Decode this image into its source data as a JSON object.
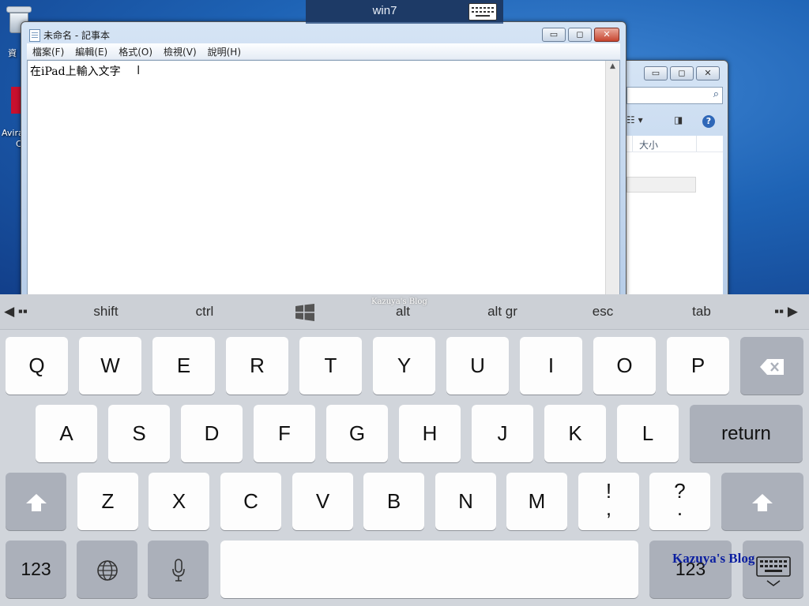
{
  "remote_bar": {
    "title": "win7",
    "keyboard_icon": "keyboard-icon"
  },
  "desktop": {
    "icons": [
      {
        "label": "資",
        "icon": "recycle-bin-icon"
      },
      {
        "label_line1": "Avira",
        "label_line2": "C",
        "icon": "avira-icon"
      }
    ]
  },
  "notepad": {
    "title": "未命名 - 記事本",
    "menu": [
      "檔案(F)",
      "編輯(E)",
      "格式(O)",
      "檢視(V)",
      "說明(H)"
    ],
    "content": "在iPad上輸入文字",
    "window_buttons": {
      "minimize": "▭",
      "maximize": "◻",
      "close": "✕"
    }
  },
  "explorer": {
    "window_buttons": {
      "minimize": "▭",
      "maximize": "◻",
      "close": "✕"
    },
    "column_header": "大小",
    "help": "?"
  },
  "keyboard": {
    "function_row": {
      "left_arrow": "◀",
      "shift": "shift",
      "ctrl": "ctrl",
      "watermark": "Kazuya's Blog",
      "alt": "alt",
      "altgr": "alt gr",
      "esc": "esc",
      "tab": "tab",
      "right_arrow": "▶"
    },
    "row1": [
      "Q",
      "W",
      "E",
      "R",
      "T",
      "Y",
      "U",
      "I",
      "O",
      "P"
    ],
    "row2": [
      "A",
      "S",
      "D",
      "F",
      "G",
      "H",
      "J",
      "K",
      "L"
    ],
    "return": "return",
    "row3": [
      "Z",
      "X",
      "C",
      "V",
      "B",
      "N",
      "M"
    ],
    "punct1_top": "!",
    "punct1_bottom": ",",
    "punct2_top": "?",
    "punct2_bottom": ".",
    "numbers_left": "123",
    "numbers_right": "123",
    "blog_label": "Kazuya's Blog"
  }
}
